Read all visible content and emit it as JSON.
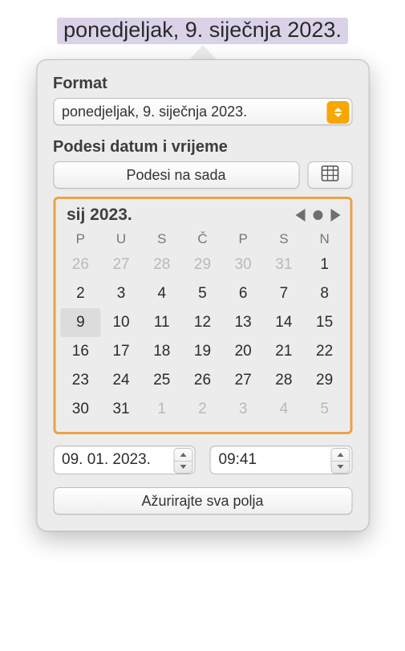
{
  "field_display": "ponedjeljak, 9. siječnja 2023.",
  "format": {
    "label": "Format",
    "selected": "ponedjeljak, 9. siječnja 2023."
  },
  "adjust": {
    "label": "Podesi datum i vrijeme",
    "set_now": "Podesi na sada",
    "calendar_icon": "calendar-icon"
  },
  "calendar": {
    "month_label": "sij 2023.",
    "weekdays": [
      "P",
      "U",
      "S",
      "Č",
      "P",
      "S",
      "N"
    ],
    "weeks": [
      [
        {
          "d": "26",
          "out": true
        },
        {
          "d": "27",
          "out": true
        },
        {
          "d": "28",
          "out": true
        },
        {
          "d": "29",
          "out": true
        },
        {
          "d": "30",
          "out": true
        },
        {
          "d": "31",
          "out": true
        },
        {
          "d": "1"
        }
      ],
      [
        {
          "d": "2"
        },
        {
          "d": "3"
        },
        {
          "d": "4"
        },
        {
          "d": "5"
        },
        {
          "d": "6"
        },
        {
          "d": "7"
        },
        {
          "d": "8"
        }
      ],
      [
        {
          "d": "9",
          "sel": true
        },
        {
          "d": "10"
        },
        {
          "d": "11"
        },
        {
          "d": "12"
        },
        {
          "d": "13"
        },
        {
          "d": "14"
        },
        {
          "d": "15"
        }
      ],
      [
        {
          "d": "16"
        },
        {
          "d": "17"
        },
        {
          "d": "18"
        },
        {
          "d": "19"
        },
        {
          "d": "20"
        },
        {
          "d": "21"
        },
        {
          "d": "22"
        }
      ],
      [
        {
          "d": "23"
        },
        {
          "d": "24"
        },
        {
          "d": "25"
        },
        {
          "d": "26"
        },
        {
          "d": "27"
        },
        {
          "d": "28"
        },
        {
          "d": "29"
        }
      ],
      [
        {
          "d": "30"
        },
        {
          "d": "31"
        },
        {
          "d": "1",
          "out": true
        },
        {
          "d": "2",
          "out": true
        },
        {
          "d": "3",
          "out": true
        },
        {
          "d": "4",
          "out": true
        },
        {
          "d": "5",
          "out": true
        }
      ]
    ]
  },
  "date_value": "09. 01. 2023.",
  "time_value": "09:41",
  "update_all": "Ažurirajte sva polja"
}
